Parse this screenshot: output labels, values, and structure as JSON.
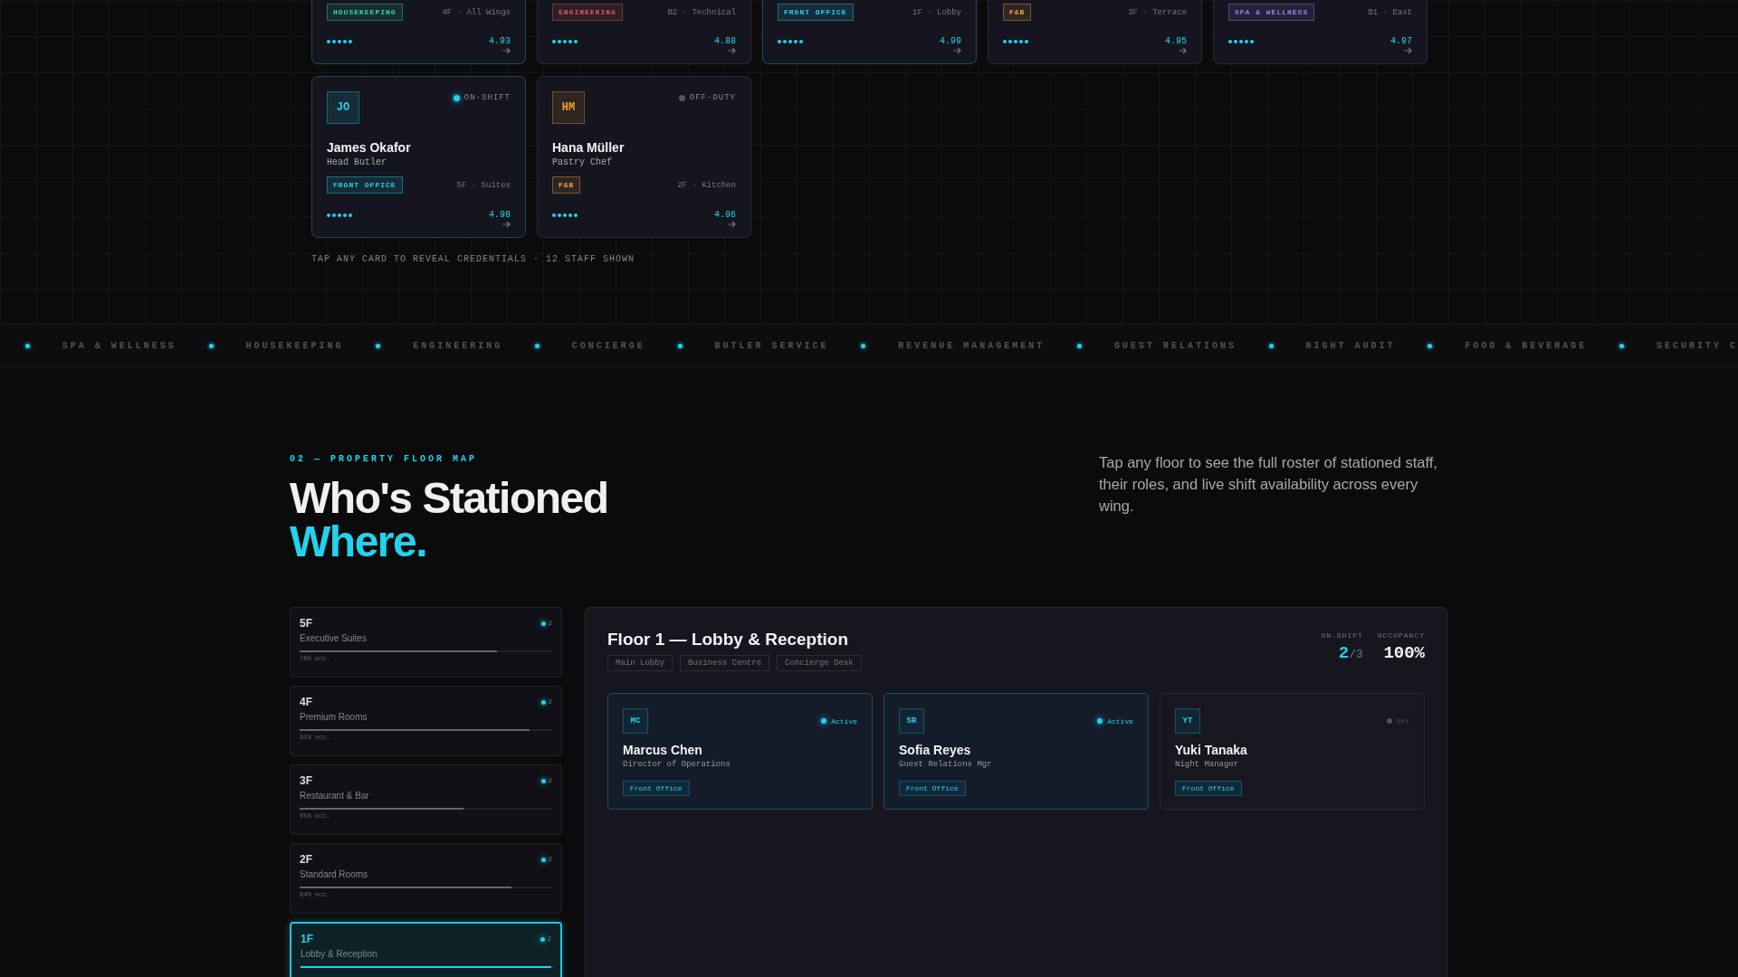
{
  "partial_cards": [
    {
      "department": "HOUSEKEEPING",
      "color": "#2fd6a8",
      "location": "4F · All Wings",
      "stars": 5,
      "rating": "4.93",
      "highlighted": true
    },
    {
      "department": "ENGINEERING",
      "color": "#e0585e",
      "location": "B2 · Technical",
      "stars": 5,
      "rating": "4.88",
      "highlighted": false
    },
    {
      "department": "FRONT OFFICE",
      "color": "#22d3ee",
      "location": "1F · Lobby",
      "stars": 5,
      "rating": "4.99",
      "highlighted": true
    },
    {
      "department": "F&B",
      "color": "#f0a23a",
      "location": "3F · Terrace",
      "stars": 5,
      "rating": "4.95",
      "highlighted": false
    },
    {
      "department": "SPA & WELLNESS",
      "color": "#a07ef0",
      "location": "B1 · East",
      "stars": 5,
      "rating": "4.97",
      "highlighted": false
    }
  ],
  "staff_cards": [
    {
      "initials": "JO",
      "status": "ON-SHIFT",
      "on_shift": true,
      "name": "James Okafor",
      "role": "Head Butler",
      "department": "FRONT OFFICE",
      "color": "#22d3ee",
      "location": "5F · Suites",
      "stars": 5,
      "rating": "4.98",
      "highlighted": true
    },
    {
      "initials": "HM",
      "status": "OFF-DUTY",
      "on_shift": false,
      "name": "Hana Müller",
      "role": "Pastry Chef",
      "department": "F&B",
      "color": "#f0a23a",
      "location": "2F · Kitchen",
      "stars": 5,
      "rating": "4.96",
      "highlighted": false
    }
  ],
  "grid_note": "TAP ANY CARD TO REVEAL CREDENTIALS · 12 STAFF SHOWN",
  "ticker": [
    "SPA & WELLNESS",
    "HOUSEKEEPING",
    "ENGINEERING",
    "CONCIERGE",
    "BUTLER SERVICE",
    "REVENUE MANAGEMENT",
    "GUEST RELATIONS",
    "NIGHT AUDIT",
    "FOOD & BEVERAGE",
    "SECURITY C"
  ],
  "section": {
    "eyebrow": "02 — PROPERTY FLOOR MAP",
    "title": "Who's Stationed",
    "title_accent": "Where.",
    "description": "Tap any floor to see the full roster of stationed staff, their roles, and live shift availability across every wing."
  },
  "floors": [
    {
      "label": "5F",
      "name": "Executive Suites",
      "count": "2",
      "level": 0.78,
      "occupancy": "78% occ.",
      "selected": false
    },
    {
      "label": "4F",
      "name": "Premium Rooms",
      "count": "2",
      "level": 0.91,
      "occupancy": "91% occ.",
      "selected": false
    },
    {
      "label": "3F",
      "name": "Restaurant & Bar",
      "count": "2",
      "level": 0.65,
      "occupancy": "65% occ.",
      "selected": false
    },
    {
      "label": "2F",
      "name": "Standard Rooms",
      "count": "2",
      "level": 0.84,
      "occupancy": "84% occ.",
      "selected": false
    },
    {
      "label": "1F",
      "name": "Lobby & Reception",
      "count": "2",
      "level": 1,
      "selected": true
    }
  ],
  "floor_panel": {
    "title": "Floor 1 — Lobby & Reception",
    "areas": [
      "Main Lobby",
      "Business Centre",
      "Concierge Desk"
    ],
    "on_shift_label": "ON-SHIFT",
    "on_shift_count": "2",
    "on_shift_total": "/3",
    "occupancy_label": "OCCUPANCY",
    "occupancy": "100%",
    "staff": [
      {
        "initials": "MC",
        "status": "Active",
        "active": true,
        "name": "Marcus Chen",
        "role": "Director of Operations",
        "department": "Front Office"
      },
      {
        "initials": "SR",
        "status": "Active",
        "active": true,
        "name": "Sofia Reyes",
        "role": "Guest Relations Mgr",
        "department": "Front Office"
      },
      {
        "initials": "YT",
        "status": "Off",
        "active": false,
        "name": "Yuki Tanaka",
        "role": "Night Manager",
        "department": "Front Office"
      }
    ]
  }
}
